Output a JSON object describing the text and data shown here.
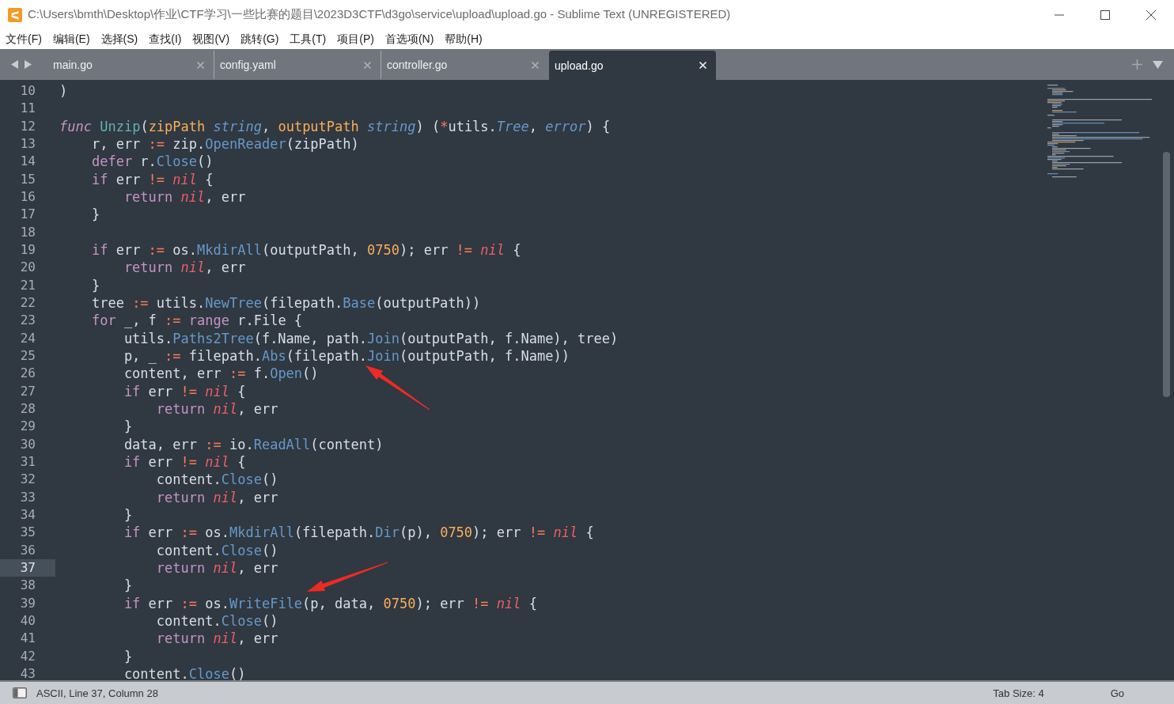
{
  "window": {
    "title": "C:\\Users\\bmth\\Desktop\\作业\\CTF学习\\一些比赛的题目\\2023D3CTF\\d3go\\service\\upload\\upload.go - Sublime Text (UNREGISTERED)"
  },
  "menu": [
    "文件(F)",
    "编辑(E)",
    "选择(S)",
    "查找(I)",
    "视图(V)",
    "跳转(G)",
    "工具(T)",
    "项目(P)",
    "首选项(N)",
    "帮助(H)"
  ],
  "tabs": [
    {
      "label": "main.go",
      "selected": false
    },
    {
      "label": "config.yaml",
      "selected": false
    },
    {
      "label": "controller.go",
      "selected": false
    },
    {
      "label": "upload.go",
      "selected": true
    }
  ],
  "lines": [
    {
      "number": "10",
      "current": false,
      "tokens": [
        {
          "kind": "plain",
          "text": ")"
        }
      ]
    },
    {
      "number": "11",
      "current": false
    },
    {
      "number": "12",
      "current": false,
      "tokens": [
        {
          "kind": "storage",
          "text": "func"
        },
        {
          "kind": "name",
          "text": " Unzip"
        },
        {
          "kind": "plain",
          "text": "("
        },
        {
          "kind": "param",
          "text": "zipPath"
        },
        {
          "kind": "type",
          "text": " string"
        },
        {
          "kind": "plain",
          "text": ", "
        },
        {
          "kind": "param",
          "text": "outputPath"
        },
        {
          "kind": "type",
          "text": " string"
        },
        {
          "kind": "plain",
          "text": ") ("
        },
        {
          "kind": "op",
          "text": "*"
        },
        {
          "kind": "plain",
          "text": "utils."
        },
        {
          "kind": "type",
          "text": "Tree"
        },
        {
          "kind": "plain",
          "text": ", "
        },
        {
          "kind": "type",
          "text": "error"
        },
        {
          "kind": "plain",
          "text": ") {"
        }
      ]
    },
    {
      "number": "13",
      "current": false,
      "tokens": [
        {
          "kind": "plain",
          "text": "    r, err "
        },
        {
          "kind": "op",
          "text": ":="
        },
        {
          "kind": "plain",
          "text": " zip."
        },
        {
          "kind": "method",
          "text": "OpenReader"
        },
        {
          "kind": "plain",
          "text": "(zipPath)"
        }
      ]
    },
    {
      "number": "14",
      "current": false,
      "tokens": [
        {
          "kind": "keyword",
          "text": "    defer"
        },
        {
          "kind": "plain",
          "text": " r."
        },
        {
          "kind": "method",
          "text": "Close"
        },
        {
          "kind": "plain",
          "text": "()"
        }
      ]
    },
    {
      "number": "15",
      "current": false,
      "tokens": [
        {
          "kind": "keyword",
          "text": "    if"
        },
        {
          "kind": "plain",
          "text": " err "
        },
        {
          "kind": "op",
          "text": "!="
        },
        {
          "kind": "nil",
          "text": " nil"
        },
        {
          "kind": "plain",
          "text": " {"
        }
      ]
    },
    {
      "number": "16",
      "current": false,
      "tokens": [
        {
          "kind": "keyword",
          "text": "        return"
        },
        {
          "kind": "nil",
          "text": " nil"
        },
        {
          "kind": "plain",
          "text": ", err"
        }
      ]
    },
    {
      "number": "17",
      "current": false,
      "tokens": [
        {
          "kind": "plain",
          "text": "    }"
        }
      ]
    },
    {
      "number": "18",
      "current": false
    },
    {
      "number": "19",
      "current": false,
      "tokens": [
        {
          "kind": "keyword",
          "text": "    if"
        },
        {
          "kind": "plain",
          "text": " err "
        },
        {
          "kind": "op",
          "text": ":="
        },
        {
          "kind": "plain",
          "text": " os."
        },
        {
          "kind": "method",
          "text": "MkdirAll"
        },
        {
          "kind": "plain",
          "text": "(outputPath, "
        },
        {
          "kind": "number",
          "text": "0750"
        },
        {
          "kind": "plain",
          "text": "); err "
        },
        {
          "kind": "op",
          "text": "!="
        },
        {
          "kind": "nil",
          "text": " nil"
        },
        {
          "kind": "plain",
          "text": " {"
        }
      ]
    },
    {
      "number": "20",
      "current": false,
      "tokens": [
        {
          "kind": "keyword",
          "text": "        return"
        },
        {
          "kind": "nil",
          "text": " nil"
        },
        {
          "kind": "plain",
          "text": ", err"
        }
      ]
    },
    {
      "number": "21",
      "current": false,
      "tokens": [
        {
          "kind": "plain",
          "text": "    }"
        }
      ]
    },
    {
      "number": "22",
      "current": false,
      "tokens": [
        {
          "kind": "plain",
          "text": "    tree "
        },
        {
          "kind": "op",
          "text": ":="
        },
        {
          "kind": "plain",
          "text": " utils."
        },
        {
          "kind": "method",
          "text": "NewTree"
        },
        {
          "kind": "plain",
          "text": "(filepath."
        },
        {
          "kind": "method",
          "text": "Base"
        },
        {
          "kind": "plain",
          "text": "(outputPath))"
        }
      ]
    },
    {
      "number": "23",
      "current": false,
      "tokens": [
        {
          "kind": "keyword",
          "text": "    for"
        },
        {
          "kind": "plain",
          "text": " _, f "
        },
        {
          "kind": "op",
          "text": ":="
        },
        {
          "kind": "keyword",
          "text": " range"
        },
        {
          "kind": "plain",
          "text": " r.File {"
        }
      ]
    },
    {
      "number": "24",
      "current": false,
      "tokens": [
        {
          "kind": "plain",
          "text": "        utils."
        },
        {
          "kind": "method",
          "text": "Paths2Tree"
        },
        {
          "kind": "plain",
          "text": "(f.Name, path."
        },
        {
          "kind": "method",
          "text": "Join"
        },
        {
          "kind": "plain",
          "text": "(outputPath, f.Name), tree)"
        }
      ]
    },
    {
      "number": "25",
      "current": false,
      "tokens": [
        {
          "kind": "plain",
          "text": "        p, _ "
        },
        {
          "kind": "op",
          "text": ":="
        },
        {
          "kind": "plain",
          "text": " filepath."
        },
        {
          "kind": "method",
          "text": "Abs"
        },
        {
          "kind": "plain",
          "text": "(filepath."
        },
        {
          "kind": "method",
          "text": "Join"
        },
        {
          "kind": "plain",
          "text": "(outputPath, f.Name))"
        }
      ]
    },
    {
      "number": "26",
      "current": false,
      "tokens": [
        {
          "kind": "plain",
          "text": "        content, err "
        },
        {
          "kind": "op",
          "text": ":="
        },
        {
          "kind": "plain",
          "text": " f."
        },
        {
          "kind": "method",
          "text": "Open"
        },
        {
          "kind": "plain",
          "text": "()"
        }
      ]
    },
    {
      "number": "27",
      "current": false,
      "tokens": [
        {
          "kind": "keyword",
          "text": "        if"
        },
        {
          "kind": "plain",
          "text": " err "
        },
        {
          "kind": "op",
          "text": "!="
        },
        {
          "kind": "nil",
          "text": " nil"
        },
        {
          "kind": "plain",
          "text": " {"
        }
      ]
    },
    {
      "number": "28",
      "current": false,
      "tokens": [
        {
          "kind": "keyword",
          "text": "            return"
        },
        {
          "kind": "nil",
          "text": " nil"
        },
        {
          "kind": "plain",
          "text": ", err"
        }
      ]
    },
    {
      "number": "29",
      "current": false,
      "tokens": [
        {
          "kind": "plain",
          "text": "        }"
        }
      ]
    },
    {
      "number": "30",
      "current": false,
      "tokens": [
        {
          "kind": "plain",
          "text": "        data, err "
        },
        {
          "kind": "op",
          "text": ":="
        },
        {
          "kind": "plain",
          "text": " io."
        },
        {
          "kind": "method",
          "text": "ReadAll"
        },
        {
          "kind": "plain",
          "text": "(content)"
        }
      ]
    },
    {
      "number": "31",
      "current": false,
      "tokens": [
        {
          "kind": "keyword",
          "text": "        if"
        },
        {
          "kind": "plain",
          "text": " err "
        },
        {
          "kind": "op",
          "text": "!="
        },
        {
          "kind": "nil",
          "text": " nil"
        },
        {
          "kind": "plain",
          "text": " {"
        }
      ]
    },
    {
      "number": "32",
      "current": false,
      "tokens": [
        {
          "kind": "plain",
          "text": "            content."
        },
        {
          "kind": "method",
          "text": "Close"
        },
        {
          "kind": "plain",
          "text": "()"
        }
      ]
    },
    {
      "number": "33",
      "current": false,
      "tokens": [
        {
          "kind": "keyword",
          "text": "            return"
        },
        {
          "kind": "nil",
          "text": " nil"
        },
        {
          "kind": "plain",
          "text": ", err"
        }
      ]
    },
    {
      "number": "34",
      "current": false,
      "tokens": [
        {
          "kind": "plain",
          "text": "        }"
        }
      ]
    },
    {
      "number": "35",
      "current": false,
      "tokens": [
        {
          "kind": "keyword",
          "text": "        if"
        },
        {
          "kind": "plain",
          "text": " err "
        },
        {
          "kind": "op",
          "text": ":="
        },
        {
          "kind": "plain",
          "text": " os."
        },
        {
          "kind": "method",
          "text": "MkdirAll"
        },
        {
          "kind": "plain",
          "text": "(filepath."
        },
        {
          "kind": "method",
          "text": "Dir"
        },
        {
          "kind": "plain",
          "text": "(p), "
        },
        {
          "kind": "number",
          "text": "0750"
        },
        {
          "kind": "plain",
          "text": "); err "
        },
        {
          "kind": "op",
          "text": "!="
        },
        {
          "kind": "nil",
          "text": " nil"
        },
        {
          "kind": "plain",
          "text": " {"
        }
      ]
    },
    {
      "number": "36",
      "current": false,
      "tokens": [
        {
          "kind": "plain",
          "text": "            content."
        },
        {
          "kind": "method",
          "text": "Close"
        },
        {
          "kind": "plain",
          "text": "()"
        }
      ]
    },
    {
      "number": "37",
      "current": true,
      "tokens": [
        {
          "kind": "keyword",
          "text": "            return"
        },
        {
          "kind": "nil",
          "text": " nil"
        },
        {
          "kind": "plain",
          "text": ", err"
        }
      ]
    },
    {
      "number": "38",
      "current": false,
      "tokens": [
        {
          "kind": "plain",
          "text": "        }"
        }
      ]
    },
    {
      "number": "39",
      "current": false,
      "tokens": [
        {
          "kind": "keyword",
          "text": "        if"
        },
        {
          "kind": "plain",
          "text": " err "
        },
        {
          "kind": "op",
          "text": ":="
        },
        {
          "kind": "plain",
          "text": " os."
        },
        {
          "kind": "method",
          "text": "WriteFile"
        },
        {
          "kind": "plain",
          "text": "(p, data, "
        },
        {
          "kind": "number",
          "text": "0750"
        },
        {
          "kind": "plain",
          "text": "); err "
        },
        {
          "kind": "op",
          "text": "!="
        },
        {
          "kind": "nil",
          "text": " nil"
        },
        {
          "kind": "plain",
          "text": " {"
        }
      ]
    },
    {
      "number": "40",
      "current": false,
      "tokens": [
        {
          "kind": "plain",
          "text": "            content."
        },
        {
          "kind": "method",
          "text": "Close"
        },
        {
          "kind": "plain",
          "text": "()"
        }
      ]
    },
    {
      "number": "41",
      "current": false,
      "tokens": [
        {
          "kind": "keyword",
          "text": "            return"
        },
        {
          "kind": "nil",
          "text": " nil"
        },
        {
          "kind": "plain",
          "text": ", err"
        }
      ]
    },
    {
      "number": "42",
      "current": false,
      "tokens": [
        {
          "kind": "plain",
          "text": "        }"
        }
      ]
    },
    {
      "number": "43",
      "current": false,
      "tokens": [
        {
          "kind": "plain",
          "text": "        content."
        },
        {
          "kind": "method",
          "text": "Close"
        },
        {
          "kind": "plain",
          "text": "()"
        }
      ]
    }
  ],
  "status_bar": {
    "position": "ASCII, Line 37, Column 28",
    "tab_size": "Tab Size: 4",
    "syntax": "Go"
  }
}
